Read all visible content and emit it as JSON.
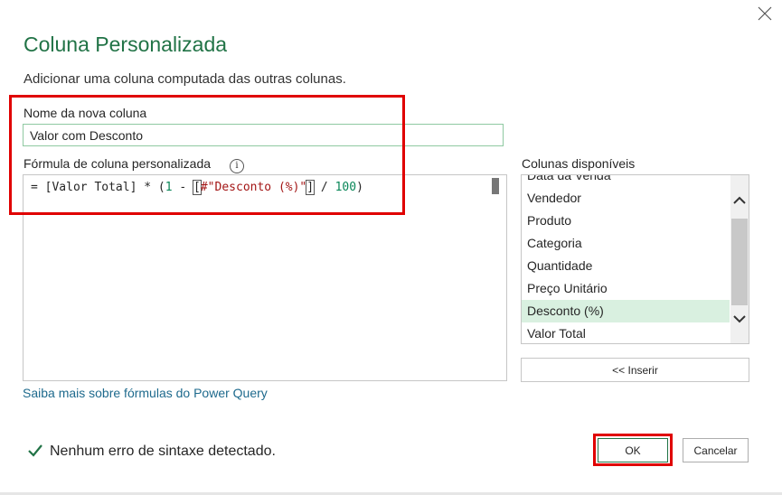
{
  "dialog": {
    "title": "Coluna Personalizada",
    "subtitle": "Adicionar uma coluna computada das outras colunas."
  },
  "new_column": {
    "label": "Nome da nova coluna",
    "value": "Valor com Desconto"
  },
  "formula": {
    "label": "Fórmula de coluna personalizada",
    "info_icon": "info-icon",
    "tokens": {
      "t1": "= [Valor Total] * (",
      "t2": "1",
      "t3": " - ",
      "t4": "[",
      "t5": "#\"Desconto (%)\"",
      "t6": "]",
      "t7": " / ",
      "t8": "100",
      "t9": ")"
    }
  },
  "columns": {
    "label": "Colunas disponíveis",
    "items": [
      "Data da Venda",
      "Vendedor",
      "Produto",
      "Categoria",
      "Quantidade",
      "Preço Unitário",
      "Desconto (%)",
      "Valor Total"
    ],
    "selected": "Desconto (%)",
    "insert_label": "<< Inserir"
  },
  "learn_more_link": "Saiba mais sobre fórmulas do Power Query",
  "status": {
    "text": "Nenhum erro de sintaxe detectado.",
    "icon": "checkmark-icon",
    "color": "#217346"
  },
  "buttons": {
    "ok_label": "OK",
    "cancel_label": "Cancelar"
  },
  "colors": {
    "accent": "#217346",
    "highlight": "#e00000",
    "selection": "#d9f0e0",
    "link": "#1e6a8d"
  }
}
